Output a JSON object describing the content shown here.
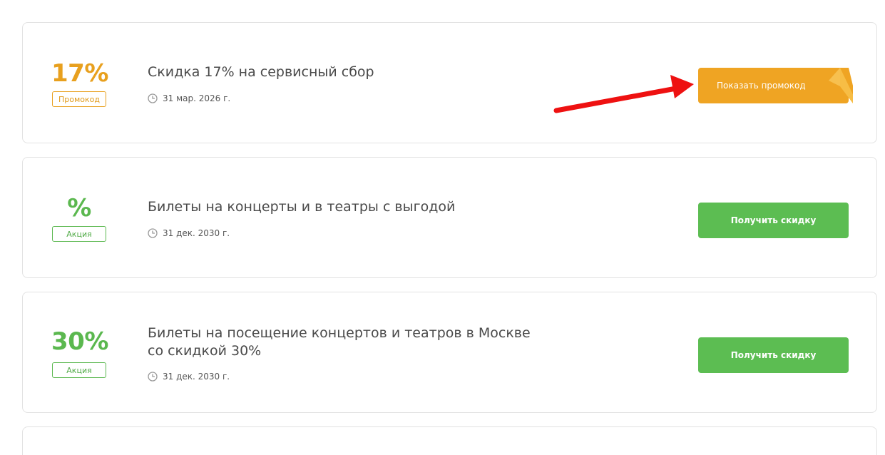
{
  "offers": [
    {
      "discount": "17%",
      "type_label": "Промокод",
      "title": "Скидка 17% на сервисный сбор",
      "date": "31 мар. 2026 г.",
      "button_label": "Показать промокод",
      "accent_color": "#efa423"
    },
    {
      "discount": "%",
      "type_label": "Акция",
      "title": "Билеты на концерты и в театры с выгодой",
      "date": "31 дек. 2030 г.",
      "button_label": "Получить скидку",
      "accent_color": "#5cbd52"
    },
    {
      "discount": "30%",
      "type_label": "Акция",
      "title": "Билеты на посещение концертов и театров в Москве со скидкой 30%",
      "date": "31 дек. 2030 г.",
      "button_label": "Получить скидку",
      "accent_color": "#5cbd52"
    }
  ],
  "annotation": {
    "arrow_color": "#ee1111",
    "arrow_target": "Показать промокод"
  }
}
